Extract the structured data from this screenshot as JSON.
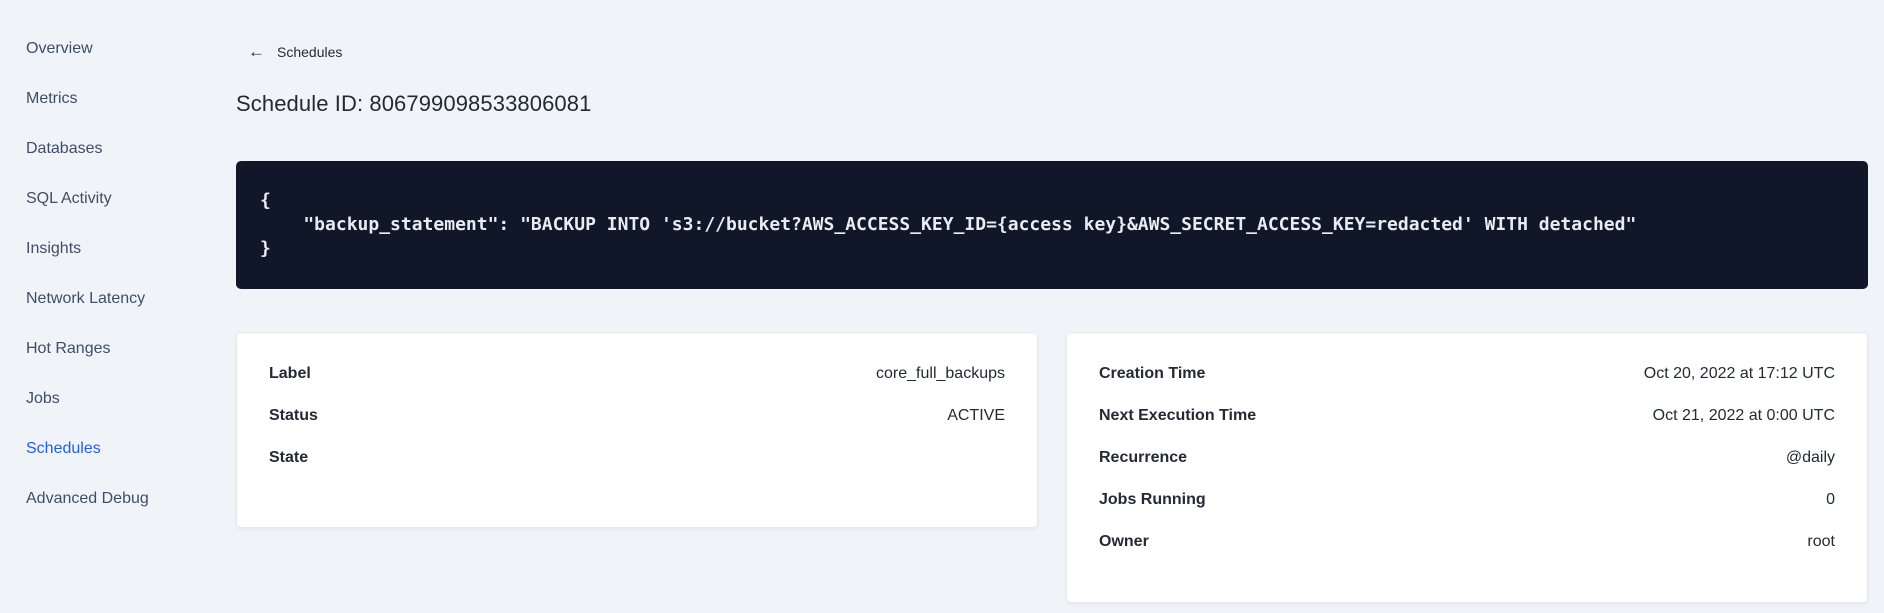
{
  "colors": {
    "page_background": "#f0f4f8",
    "active_link_blue": "#1c5ef5",
    "code_background": "#101728",
    "code_text": "#e7ebf2",
    "card_background": "#ffffff",
    "text_dark": "#242a35",
    "sidebar_text": "#3e4e68"
  },
  "sidebar": {
    "items": [
      {
        "label": "Overview"
      },
      {
        "label": "Metrics"
      },
      {
        "label": "Databases"
      },
      {
        "label": "SQL Activity"
      },
      {
        "label": "Insights"
      },
      {
        "label": "Network Latency"
      },
      {
        "label": "Hot Ranges"
      },
      {
        "label": "Jobs"
      },
      {
        "label": "Schedules",
        "active": true
      },
      {
        "label": "Advanced Debug"
      }
    ]
  },
  "header": {
    "back_arrow": "←",
    "back_label": "Schedules",
    "title": "Schedule ID: 806799098533806081"
  },
  "code_block": {
    "lines": [
      "{",
      "    \"backup_statement\": \"BACKUP INTO 's3://bucket?AWS_ACCESS_KEY_ID={access key}&AWS_SECRET_ACCESS_KEY=redacted' WITH detached\"",
      "}"
    ]
  },
  "details_left": {
    "rows": [
      {
        "label": "Label",
        "value": "core_full_backups"
      },
      {
        "label": "Status",
        "value": "ACTIVE"
      },
      {
        "label": "State",
        "value": ""
      }
    ]
  },
  "details_right": {
    "rows": [
      {
        "label": "Creation Time",
        "value": "Oct 20, 2022 at 17:12 UTC"
      },
      {
        "label": "Next Execution Time",
        "value": "Oct 21, 2022 at 0:00 UTC"
      },
      {
        "label": "Recurrence",
        "value": "@daily"
      },
      {
        "label": "Jobs Running",
        "value": "0"
      },
      {
        "label": "Owner",
        "value": "root"
      }
    ]
  }
}
